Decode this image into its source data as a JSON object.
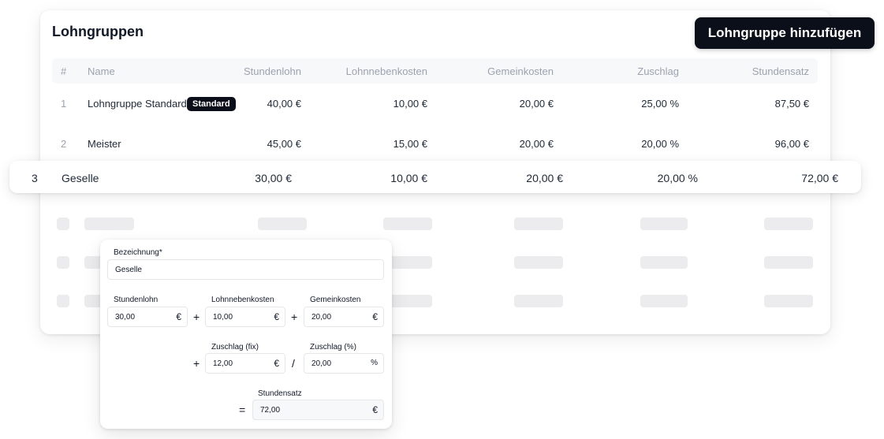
{
  "header": {
    "title": "Lohngruppen",
    "add_button_label": "Lohngruppe hinzufügen"
  },
  "table": {
    "columns": [
      "#",
      "Name",
      "Stundenlohn",
      "Lohnnebenkosten",
      "Gemeinkosten",
      "Zuschlag",
      "Stundensatz"
    ],
    "rows": [
      {
        "num": "1",
        "name": "Lohngruppe Standard",
        "badge": "Standard",
        "stundenlohn": "40,00 €",
        "lohnnebenkosten": "10,00 €",
        "gemeinkosten": "20,00 €",
        "zuschlag": "25,00 %",
        "stundensatz": "87,50 €"
      },
      {
        "num": "2",
        "name": "Meister",
        "stundenlohn": "45,00 €",
        "lohnnebenkosten": "15,00 €",
        "gemeinkosten": "20,00 €",
        "zuschlag": "20,00 %",
        "stundensatz": "96,00 €"
      },
      {
        "num": "3",
        "name": "Geselle",
        "stundenlohn": "30,00 €",
        "lohnnebenkosten": "10,00 €",
        "gemeinkosten": "20,00 €",
        "zuschlag": "20,00 %",
        "stundensatz": "72,00 €"
      }
    ]
  },
  "form": {
    "bezeichnung_label": "Bezeichnung*",
    "bezeichnung_value": "Geselle",
    "stundenlohn_label": "Stundenlohn",
    "stundenlohn_value": "30,00",
    "lohnnebenkosten_label": "Lohnnebenkosten",
    "lohnnebenkosten_value": "10,00",
    "gemeinkosten_label": "Gemeinkosten",
    "gemeinkosten_value": "20,00",
    "zuschlag_fix_label": "Zuschlag (fix)",
    "zuschlag_fix_value": "12,00",
    "zuschlag_pct_label": "Zuschlag (%)",
    "zuschlag_pct_value": "20,00",
    "stundensatz_label": "Stundensatz",
    "stundensatz_value": "72,00",
    "currency_symbol": "€",
    "percent_symbol": "%",
    "op_plus": "+",
    "op_divide": "/",
    "op_equals": "="
  },
  "icons": {
    "currency": "euro-icon",
    "percent": "percent-icon"
  },
  "colors": {
    "primary": "#0b0f19",
    "muted_text": "#9ca3af",
    "skeleton": "#ececee",
    "header_bg": "#f7f8fa"
  }
}
